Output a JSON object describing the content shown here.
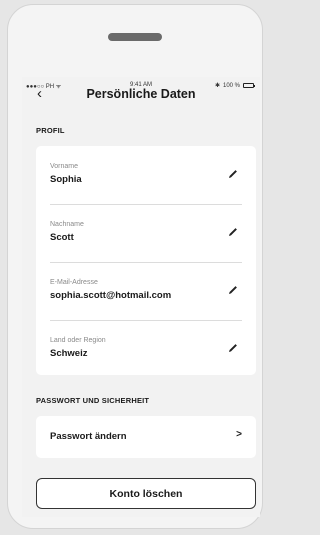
{
  "status_bar": {
    "carrier": "●●●○○ PH ᯤ",
    "time": "9:41 AM",
    "battery": "100 %",
    "battery_level": 1.0
  },
  "header": {
    "back_icon": "chevron-left-icon",
    "title": "Persönliche Daten"
  },
  "profile": {
    "section_label": "PROFIL",
    "fields": [
      {
        "label": "Vorname",
        "value": "Sophia",
        "icon": "pencil-icon"
      },
      {
        "label": "Nachname",
        "value": "Scott",
        "icon": "pencil-icon"
      },
      {
        "label": "E-Mail-Adresse",
        "value": "sophia.scott@hotmail.com",
        "icon": "pencil-icon"
      },
      {
        "label": "Land oder Region",
        "value": "Schweiz",
        "icon": "pencil-icon"
      }
    ]
  },
  "security": {
    "section_label": "PASSWORT UND SICHERHEIT",
    "change_password_label": "Passwort ändern",
    "chevron": ">"
  },
  "delete_account": {
    "label": "Konto löschen"
  }
}
